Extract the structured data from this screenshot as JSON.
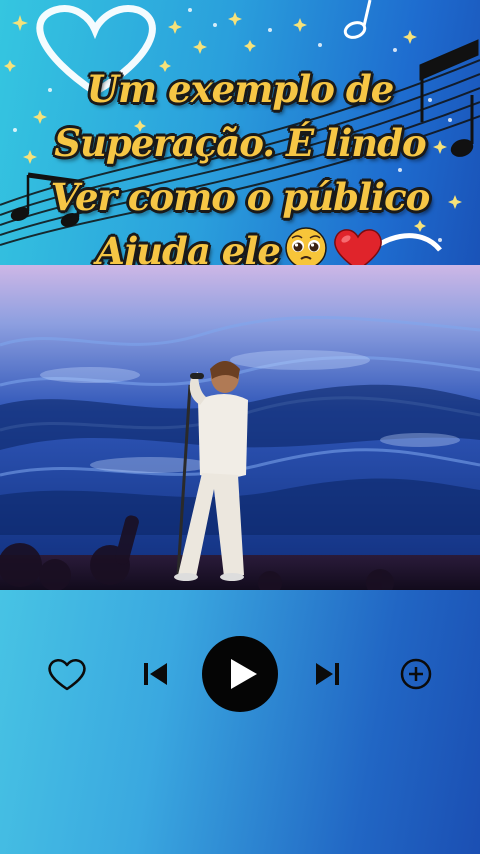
{
  "caption": {
    "lines": [
      "Um exemplo de",
      "Superação. É lindo",
      "Ver como o público",
      "Ajuda ele"
    ],
    "emojis": [
      "pleading-face-emoji",
      "red-heart-emoji"
    ]
  },
  "player": {
    "controls": [
      {
        "name": "like",
        "icon": "heart-outline-icon"
      },
      {
        "name": "previous",
        "icon": "skip-previous-icon"
      },
      {
        "name": "play",
        "icon": "play-icon"
      },
      {
        "name": "next",
        "icon": "skip-next-icon"
      },
      {
        "name": "add",
        "icon": "add-circle-icon"
      }
    ]
  },
  "colors": {
    "caption_text": "#f6c645",
    "caption_outline": "#1a1a1a",
    "icon": "#0b0b0b",
    "background_start": "#4fd3e6",
    "background_end": "#1b4fb3",
    "heart_emoji": "#e0242b",
    "face_emoji": "#f7c53a"
  }
}
